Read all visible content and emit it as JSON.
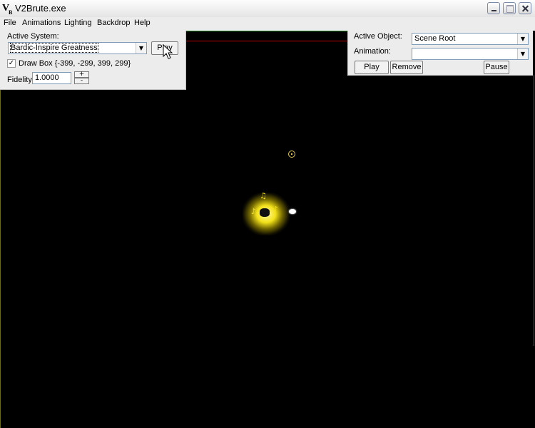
{
  "window": {
    "title": "V2Brute.exe",
    "icon": "app-logo-icon"
  },
  "menu": {
    "items": [
      "File",
      "Animations",
      "Lighting",
      "Backdrop",
      "Help"
    ]
  },
  "left_panel": {
    "active_system_label": "Active System:",
    "active_system_value": "Bardic-Inspire Greatness",
    "play_label": "Play",
    "drawbox_checked": true,
    "drawbox_label": "Draw Box {-399, -299, 399, 299}",
    "fidelity_label": "Fidelity",
    "fidelity_value": "1.0000",
    "plus_label": "+",
    "minus_label": "-"
  },
  "right_panel": {
    "active_object_label": "Active Object:",
    "active_object_value": "Scene Root",
    "animation_label": "Animation:",
    "animation_value": "",
    "play_label": "Play",
    "remove_label": "Remove",
    "pause_label": "Pause"
  },
  "colors": {
    "viewport_bg": "#000000",
    "particle_yellow": "#f3e21a",
    "panel_bg": "#ececec"
  },
  "icons": [
    "app-logo-icon",
    "minimize-icon",
    "maximize-icon",
    "close-icon",
    "chevron-down-icon",
    "checkmark-icon",
    "cursor-icon",
    "target-marker-icon"
  ]
}
